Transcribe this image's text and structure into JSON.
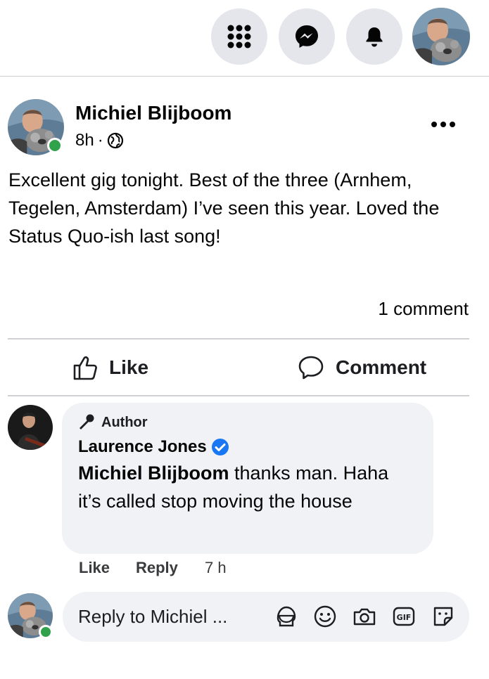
{
  "post": {
    "author": "Michiel Blijboom",
    "time": "8h",
    "separator": "·",
    "text": "Excellent gig tonight. Best of the three (Arnhem, Tegelen, Amsterdam) I’ve seen this year. Loved the Status Quo-ish last song!",
    "comment_count": "1 comment"
  },
  "actions": {
    "like": "Like",
    "comment": "Comment"
  },
  "comment": {
    "badge": "Author",
    "author": "Laurence Jones",
    "mention": "Michiel Blijboom",
    "text": " thanks man. Haha it’s called stop moving the house",
    "like": "Like",
    "reply": "Reply",
    "time": "7 h"
  },
  "reply_box": {
    "placeholder": "Reply to Michiel ..."
  },
  "icons": {
    "menu": "grid-menu-icon",
    "messenger": "messenger-icon",
    "notifications": "bell-icon",
    "privacy": "globe-icon",
    "more": "more-options-icon",
    "like": "thumbs-up-icon",
    "comment": "comment-bubble-icon",
    "badge": "microphone-icon",
    "verified": "verified-badge-icon",
    "avatar_sticker": "avatar-sticker-icon",
    "emoji": "emoji-icon",
    "camera": "camera-icon",
    "gif": "gif-icon",
    "sticker": "sticker-icon"
  },
  "colors": {
    "online": "#31a24c",
    "verified": "#1877f2",
    "bubble": "#f0f2f5"
  }
}
